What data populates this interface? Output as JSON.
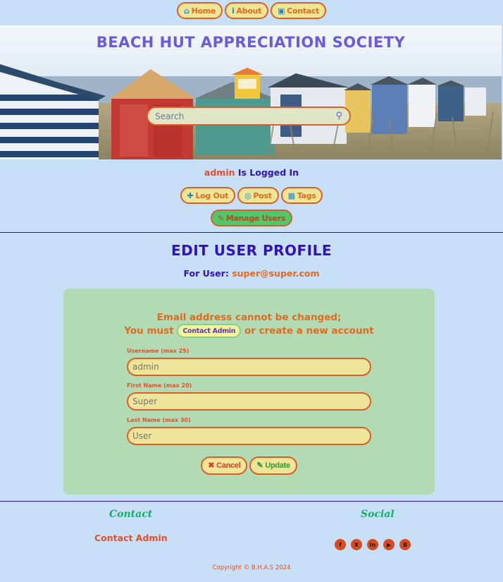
{
  "topnav": [
    {
      "icon": "home-icon",
      "glyph": "⌂",
      "label": "Home"
    },
    {
      "icon": "info-icon",
      "glyph": "i",
      "label": "About"
    },
    {
      "icon": "address-book-icon",
      "glyph": "▣",
      "label": "Contact"
    }
  ],
  "header": {
    "title": "BEACH HUT APPRECIATION SOCIETY",
    "search_placeholder": "Search"
  },
  "login": {
    "username": "admin",
    "status_text": "Is Logged In"
  },
  "usernav": [
    {
      "icon": "user-plus-icon",
      "glyph": "✚",
      "label": "Log Out"
    },
    {
      "icon": "post-icon",
      "glyph": "◎",
      "label": "Post"
    },
    {
      "icon": "tags-icon",
      "glyph": "▦",
      "label": "Tags"
    }
  ],
  "manage": {
    "icon": "wrench-icon",
    "glyph": "✎",
    "label": "Manage Users"
  },
  "page": {
    "heading": "EDIT USER PROFILE",
    "for_user_label": "For User:",
    "for_user_email": "super@super.com"
  },
  "form": {
    "notice_line1": "Email address cannot be changed;",
    "notice_before": "You must",
    "notice_button": "Contact Admin",
    "notice_after": "or create a new account",
    "username_label": "Username (max 25)",
    "username_value": "admin",
    "firstname_label": "First Name (max 20)",
    "firstname_value": "Super",
    "lastname_label": "Last Name (max 30)",
    "lastname_value": "User",
    "cancel_label": "Cancel",
    "update_label": "Update"
  },
  "footer": {
    "contact_heading": "Contact",
    "contact_link": "Contact Admin",
    "social_heading": "Social",
    "social": [
      {
        "icon": "facebook-icon",
        "glyph": "f"
      },
      {
        "icon": "x-twitter-icon",
        "glyph": "X"
      },
      {
        "icon": "linkedin-icon",
        "glyph": "in"
      },
      {
        "icon": "youtube-icon",
        "glyph": "▶"
      },
      {
        "icon": "blogger-icon",
        "glyph": "B"
      }
    ],
    "copyright": "Copyright © B.H.A.S 2024"
  }
}
